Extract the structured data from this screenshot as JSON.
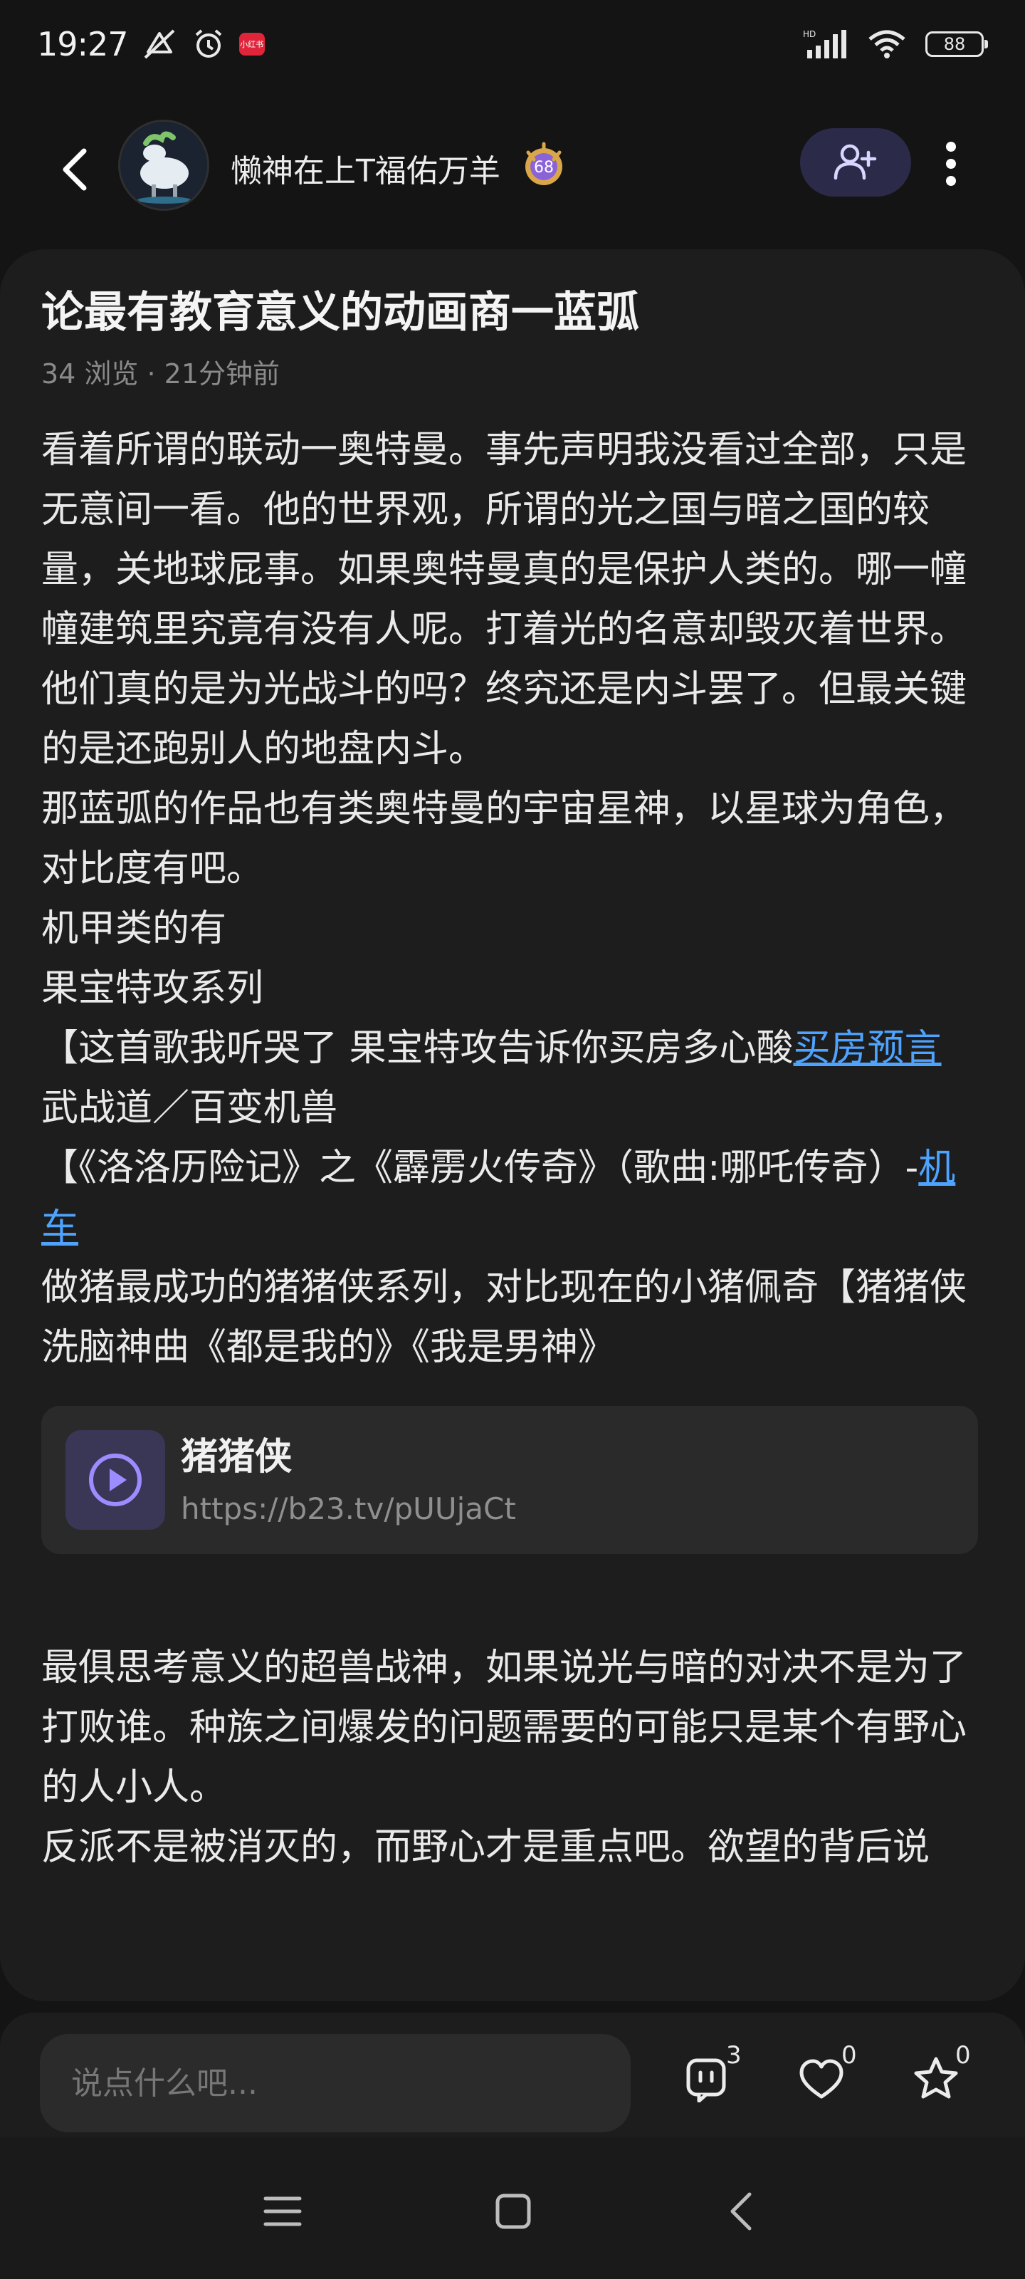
{
  "status_bar": {
    "time": "19:27",
    "app_badge": "小红书",
    "battery": "88",
    "network": "HD"
  },
  "header": {
    "username": "懒神在上T福佑万羊",
    "level": "68"
  },
  "post": {
    "title": "论最有教育意义的动画商一蓝弧",
    "meta": "34 浏览 · 21分钟前",
    "paragraphs": [
      "看着所谓的联动一奥特曼。事先声明我没看过全部，只是无意间一看。他的世界观，所谓的光之国与暗之国的较量，关地球屁事。如果奥特曼真的是保护人类的。哪一幢幢建筑里究竟有没有人呢。打着光的名意却毁灭着世界。他们真的是为光战斗的吗？终究还是内斗罢了。但最关键的是还跑别人的地盘内斗。",
      "那蓝弧的作品也有类奥特曼的宇宙星神，以星球为角色，对比度有吧。",
      "机甲类的有",
      "果宝特攻系列"
    ],
    "p5_text": "【这首歌我听哭了 果宝特攻告诉你买房多心酸",
    "p5_link": "买房预言",
    "p6_text": "武战道／百变机兽",
    "p7_text": "【《洛洛历险记》之《霹雳火传奇》（歌曲:哪吒传奇）-",
    "p7_link": "机车",
    "p8_text": "做猪最成功的猪猪侠系列，对比现在的小猪佩奇【猪猪侠洗脑神曲《都是我的》《我是男神》",
    "link_card": {
      "title": "猪猪侠",
      "url": "https://b23.tv/pUUjaCt"
    },
    "tail_paragraphs": [
      "最俱思考意义的超兽战神，如果说光与暗的对决不是为了打败谁。种族之间爆发的问题需要的可能只是某个有野心的人小人。",
      "反派不是被消灭的，而野心才是重点吧。欲望的背后说"
    ]
  },
  "bottom_bar": {
    "comment_placeholder": "说点什么吧...",
    "comment_count": "3",
    "like_count": "0",
    "star_count": "0"
  },
  "colors": {
    "background": "#141414",
    "card": "#1d1d1d",
    "link": "#4ea3ff",
    "follow_button": "#2c2a49",
    "play_icon": "#9b8cff"
  },
  "icons": {
    "back": "chevron-left-icon",
    "follow": "add-user-icon",
    "more": "more-vertical-icon",
    "comment": "comment-icon",
    "like": "heart-icon",
    "star": "star-icon",
    "play": "play-icon"
  }
}
